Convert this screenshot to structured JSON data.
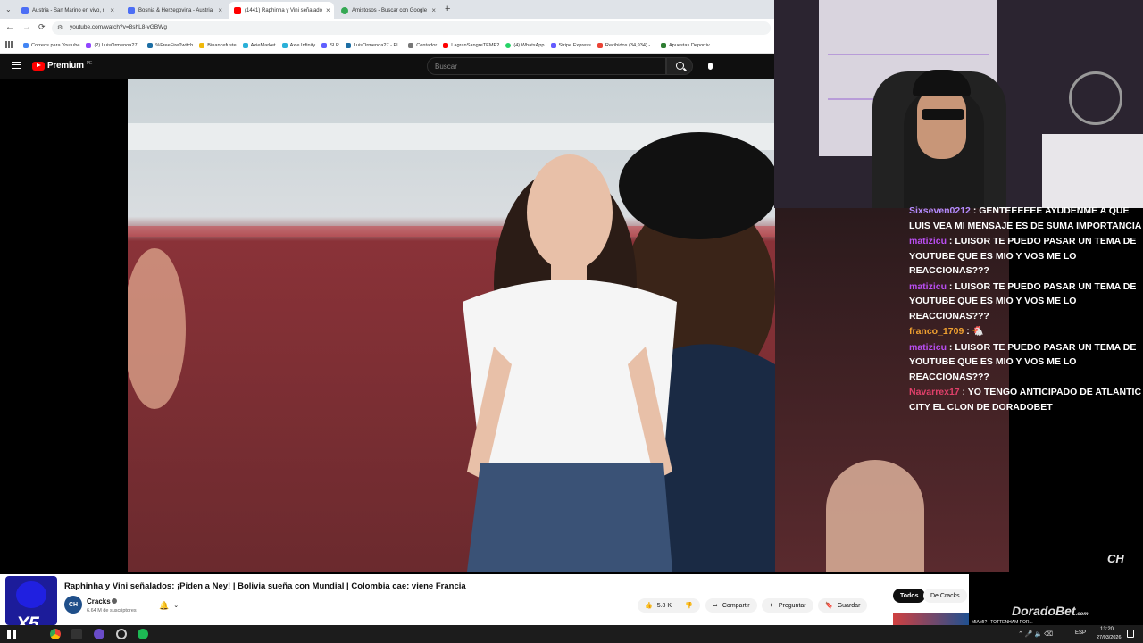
{
  "browser": {
    "tabs": [
      {
        "title": "Austria - San Marino en vivo, r",
        "color": "#4c6ef5"
      },
      {
        "title": "Bosnia & Herzegovina - Austria",
        "color": "#4c6ef5"
      },
      {
        "title": "(1441) Raphinha y Vini señalado",
        "color": "#ff0000"
      },
      {
        "title": "Amistosos - Buscar con Google",
        "color": "#34a853"
      }
    ],
    "url": "youtube.com/watch?v=8shL8-vGBWg",
    "bookmarks": [
      "Correos para Youtube",
      "(2) LuisOrmenoa27...",
      "%FreeFireTwitch",
      "Binancefuste",
      "AxieMarket",
      "Axie Infinity",
      "SLP",
      "LuisOrmenoa27 - Pl...",
      "Contador",
      "LagranSangreTEMP2",
      "(4) WhatsApp",
      "Stripe Express",
      "Recibidos (34,934) -...",
      "Apuestas Deportiv..."
    ]
  },
  "youtube": {
    "logo": "Premium",
    "logo_sup": "PE",
    "search_placeholder": "Buscar",
    "video_title": "Raphinha y Vini señalados: ¡Piden a Ney! | Bolivia sueña con Mundial | Colombia cae: viene Francia",
    "channel": "Cracks",
    "channel_avatar": "CH",
    "subscribers": "6.64 M de suscriptores",
    "likes": "5.8 K",
    "share": "Compartir",
    "ask": "Preguntar",
    "save": "Guardar",
    "chips": [
      "Todos",
      "De Cracks"
    ],
    "watermark": "CH",
    "up_next": "MIAMI? | TOTTENHAM POR..."
  },
  "stream": {
    "chat": [
      {
        "user": "Sixseven0212",
        "color": "#b48cff",
        "text": "GENTEEEEEE AYUDENME A QUE LUIS VEA MI MENSAJE ES DE SUMA IMPORTANCIA"
      },
      {
        "user": "matizicu",
        "color": "#b94ef0",
        "text": "LUISOR TE PUEDO PASAR UN TEMA DE YOUTUBE QUE ES MIO Y VOS ME LO REACCIONAS???"
      },
      {
        "user": "matizicu",
        "color": "#b94ef0",
        "text": "LUISOR TE PUEDO PASAR UN TEMA DE YOUTUBE QUE ES MIO Y VOS ME LO REACCIONAS???"
      },
      {
        "user": "franco_1709",
        "color": "#f0a030",
        "text": "🐔"
      },
      {
        "user": "matizicu",
        "color": "#b94ef0",
        "text": "LUISOR TE PUEDO PASAR UN TEMA DE YOUTUBE QUE ES MIO Y VOS ME LO REACCIONAS???"
      },
      {
        "user": "Navarrex17",
        "color": "#e0406a",
        "text": "YO TENGO ANTICIPADO DE ATLANTIC CITY EL CLON DE DORADOBET"
      }
    ],
    "sponsor": "DoradoBet",
    "sponsor_suffix": ".com",
    "multiplier": "X5"
  },
  "taskbar": {
    "lang": "ESP",
    "time": "13:20",
    "date": "27/03/2026"
  }
}
